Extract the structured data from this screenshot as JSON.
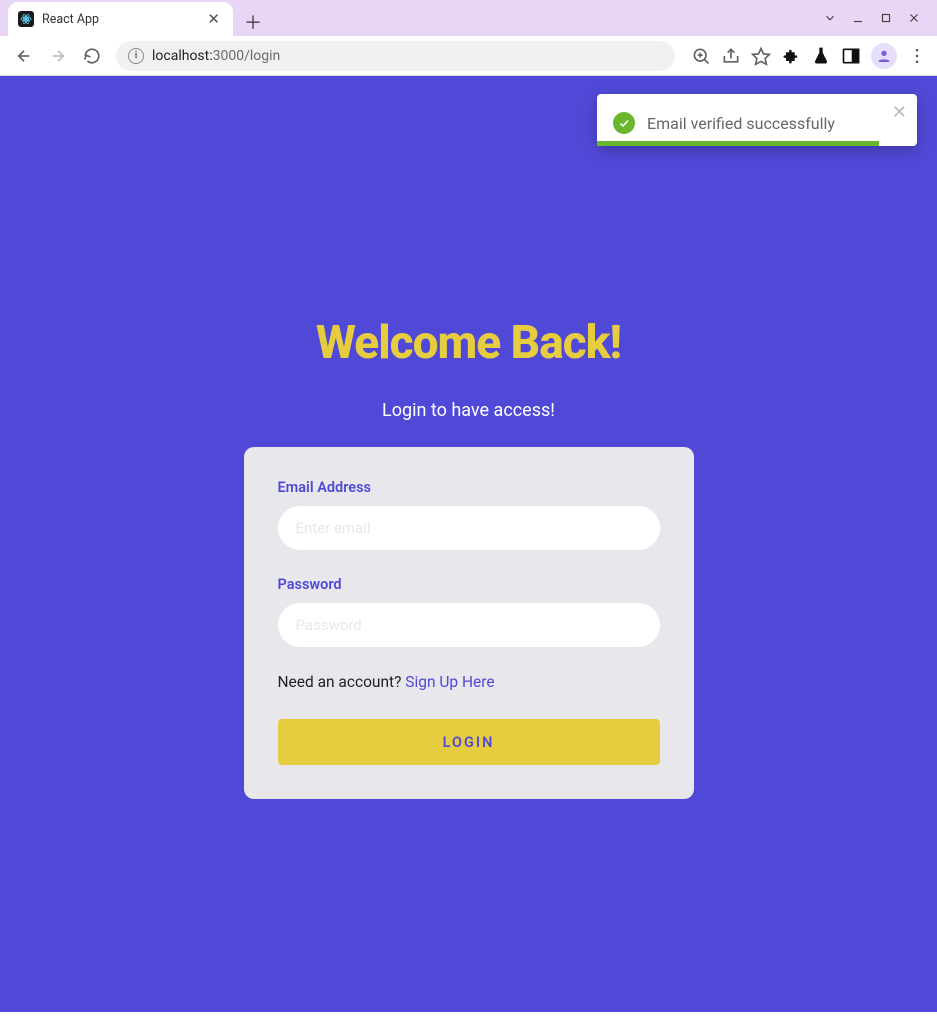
{
  "browser": {
    "tab_title": "React App",
    "url_host": "localhost:",
    "url_port_path": "3000/login"
  },
  "toast": {
    "message": "Email verified successfully"
  },
  "page": {
    "heading": "Welcome Back!",
    "subheading": "Login to have access!"
  },
  "form": {
    "email_label": "Email Address",
    "email_placeholder": "Enter email",
    "password_label": "Password",
    "password_placeholder": "Password",
    "signup_prompt": "Need an account? ",
    "signup_link": "Sign Up Here",
    "login_button": "LOGIN"
  }
}
